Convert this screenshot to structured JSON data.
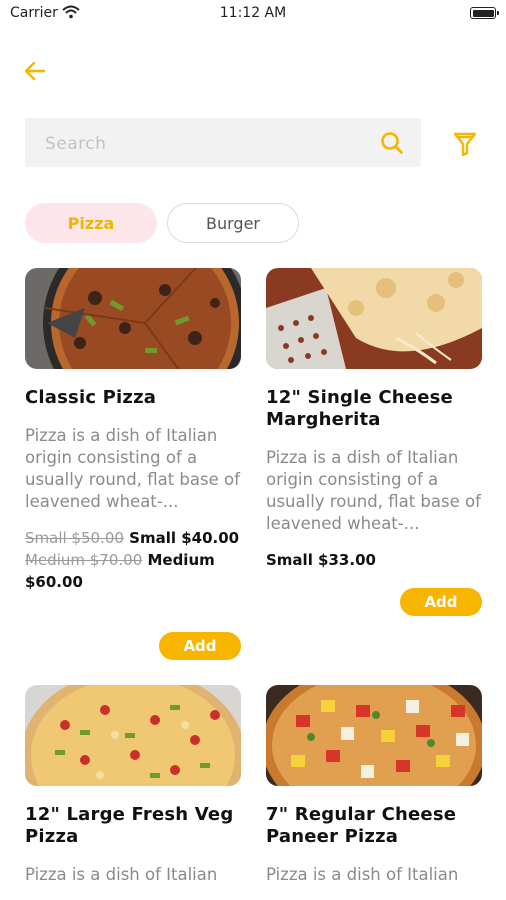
{
  "status_bar": {
    "carrier": "Carrier",
    "time": "11:12 AM"
  },
  "search": {
    "placeholder": "Search"
  },
  "categories": [
    {
      "label": "Pizza",
      "selected": true
    },
    {
      "label": "Burger",
      "selected": false
    }
  ],
  "colors": {
    "accent": "#f7b500",
    "chip_selected_bg": "#fde6ea"
  },
  "products": [
    {
      "title": "Classic Pizza",
      "description": "Pizza is a dish of Italian origin consisting of a usually round, flat base of leavened wheat-...",
      "prices": [
        {
          "old": "Small $50.00",
          "new": "Small $40.00"
        },
        {
          "old": "Medium $70.00",
          "new": "Medium $60.00"
        }
      ],
      "add_label": "Add"
    },
    {
      "title": "12\" Single Cheese Margherita",
      "description": "Pizza is a dish of Italian origin consisting of a usually round, flat base of leavened wheat-...",
      "prices": [
        {
          "new": "Small $33.00"
        }
      ],
      "add_label": "Add"
    },
    {
      "title": "12\" Large Fresh Veg Pizza",
      "description": "Pizza is a dish of Italian"
    },
    {
      "title": "7\" Regular Cheese Paneer Pizza",
      "description": "Pizza is a dish of Italian"
    }
  ]
}
